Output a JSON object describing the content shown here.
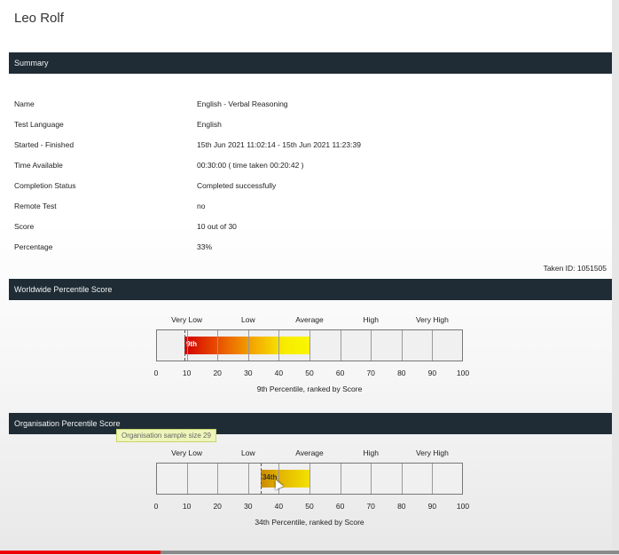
{
  "person": {
    "name": "Leo Rolf"
  },
  "summary": {
    "title": "Summary",
    "rows": [
      {
        "label": "Name",
        "value": "English - Verbal Reasoning"
      },
      {
        "label": "Test Language",
        "value": "English"
      },
      {
        "label": "Started - Finished",
        "value": "15th Jun 2021 11:02:14 - 15th Jun 2021 11:23:39"
      },
      {
        "label": "Time Available",
        "value": "00:30:00 ( time taken 00:20:42 )"
      },
      {
        "label": "Completion Status",
        "value": "Completed successfully"
      },
      {
        "label": "Remote Test",
        "value": "no"
      },
      {
        "label": "Score",
        "value": "10 out of 30"
      },
      {
        "label": "Percentage",
        "value": "33%"
      }
    ],
    "taken_id": "Taken ID: 1051505"
  },
  "worldwide": {
    "title": "Worldwide Percentile Score",
    "caption": "9th Percentile, ranked by Score",
    "bar_label": "9th"
  },
  "organisation": {
    "title": "Organisation Percentile Score",
    "tooltip": "Organisation sample size 29",
    "caption": "34th Percentile, ranked by Score",
    "bar_label": "34th"
  },
  "bands": [
    "Very Low",
    "Low",
    "Average",
    "High",
    "Very High"
  ],
  "ticks": [
    "0",
    "10",
    "20",
    "30",
    "40",
    "50",
    "60",
    "70",
    "80",
    "90",
    "100"
  ],
  "chart_data": [
    {
      "type": "bar",
      "title": "Worldwide Percentile Score",
      "xlim": [
        0,
        100
      ],
      "bands": [
        "Very Low",
        "Low",
        "Average",
        "High",
        "Very High"
      ],
      "percentile": 9,
      "bar_end": 50,
      "label": "9th"
    },
    {
      "type": "bar",
      "title": "Organisation Percentile Score",
      "xlim": [
        0,
        100
      ],
      "bands": [
        "Very Low",
        "Low",
        "Average",
        "High",
        "Very High"
      ],
      "percentile": 34,
      "bar_end": 50,
      "label": "34th"
    }
  ],
  "video_progress": 0.26,
  "colors": {
    "header_bar": "#1f2c35",
    "progress": "#e00000"
  }
}
